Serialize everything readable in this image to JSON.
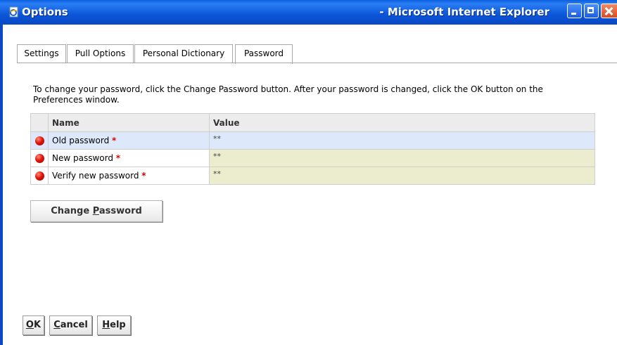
{
  "window": {
    "title": "Options",
    "browser_suffix": "- Microsoft Internet Explorer",
    "icon": "ie-page-icon"
  },
  "tabs": [
    {
      "label": "Settings",
      "active": false
    },
    {
      "label": "Pull Options",
      "active": false
    },
    {
      "label": "Personal Dictionary",
      "active": false
    },
    {
      "label": "Password",
      "active": true
    }
  ],
  "instructions": "To change your password, click the Change Password button. After your password is changed, click the OK button on the Preferences window.",
  "table": {
    "headers": {
      "name": "Name",
      "value": "Value"
    },
    "rows": [
      {
        "name": "Old password",
        "required": "*",
        "value": "**",
        "selected": true
      },
      {
        "name": "New password",
        "required": "*",
        "value": "**",
        "selected": false
      },
      {
        "name": "Verify new password",
        "required": "*",
        "value": "**",
        "selected": false
      }
    ]
  },
  "change_password": {
    "pre": "Change ",
    "accel": "P",
    "post": "assword"
  },
  "footer": {
    "ok": {
      "accel": "O",
      "rest": "K"
    },
    "cancel": {
      "accel": "C",
      "rest": "ancel"
    },
    "help": {
      "accel": "H",
      "rest": "elp"
    }
  },
  "colors": {
    "titlebar": "#0a5fe0",
    "selected_row": "#dde9fb",
    "value_cell": "#ecedcf",
    "required_star": "#e00000",
    "status_dot": "#e0180a"
  }
}
